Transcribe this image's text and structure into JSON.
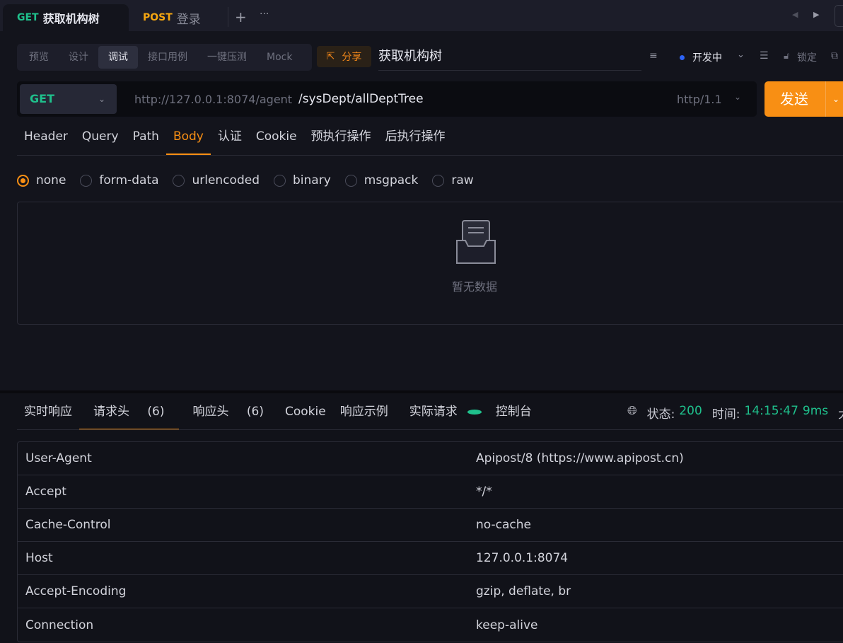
{
  "tabs": [
    {
      "method": "GET",
      "name": "获取机构树",
      "active": true
    },
    {
      "method": "POST",
      "name": "登录",
      "active": false
    }
  ],
  "toolbar": {
    "modes": [
      "预览",
      "设计",
      "调试",
      "接口用例",
      "一键压测",
      "Mock"
    ],
    "active_mode": "调试",
    "share": "分享",
    "api_name": "获取机构树",
    "env": "开发中",
    "lock": "锁定"
  },
  "request": {
    "method": "GET",
    "base_url": "http://127.0.0.1:8074/agent",
    "path": "/sysDept/allDeptTree",
    "protocol": "http/1.1",
    "send": "发送"
  },
  "req_tabs": [
    "Header",
    "Query",
    "Path",
    "Body",
    "认证",
    "Cookie",
    "预执行操作",
    "后执行操作"
  ],
  "active_req_tab": "Body",
  "body_types": [
    "none",
    "form-data",
    "urlencoded",
    "binary",
    "msgpack",
    "raw"
  ],
  "selected_body_type": "none",
  "empty_text": "暂无数据",
  "resp_tabs": [
    {
      "label": "实时响应"
    },
    {
      "label": "请求头",
      "count": "(6)"
    },
    {
      "label": "响应头",
      "count": "(6)"
    },
    {
      "label": "Cookie"
    },
    {
      "label": "响应示例"
    },
    {
      "label": "实际请求"
    },
    {
      "label": "控制台"
    }
  ],
  "status": {
    "status_label": "状态:",
    "status_code": "200",
    "time_label": "时间:",
    "time": "14:15:47",
    "duration": "9ms",
    "more": "大"
  },
  "headers": [
    {
      "key": "User-Agent",
      "value": "Apipost/8 (https://www.apipost.cn)"
    },
    {
      "key": "Accept",
      "value": "*/*"
    },
    {
      "key": "Cache-Control",
      "value": "no-cache"
    },
    {
      "key": "Host",
      "value": "127.0.0.1:8074"
    },
    {
      "key": "Accept-Encoding",
      "value": "gzip, deflate, br"
    },
    {
      "key": "Connection",
      "value": "keep-alive"
    }
  ],
  "colors": {
    "accent": "#f88f14",
    "get": "#1fc08c",
    "post": "#f5a611",
    "env_dot": "#2d63f5"
  }
}
